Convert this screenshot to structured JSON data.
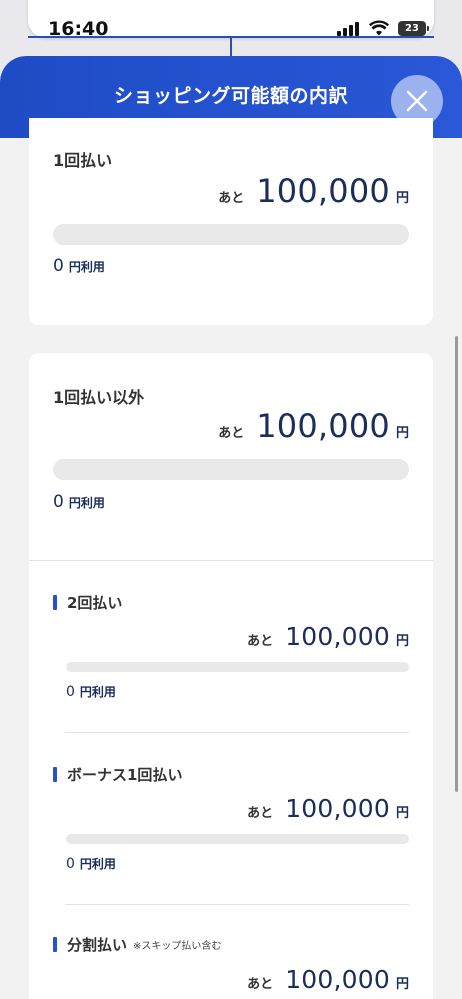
{
  "status_bar": {
    "time": "16:40",
    "battery": "23"
  },
  "sheet": {
    "title": "ショッピング可能額の内訳"
  },
  "lump_sum": {
    "label": "1回払い",
    "remaining_prefix": "あと",
    "remaining_amount": "100,000",
    "currency": "円",
    "used_amount": "0",
    "used_suffix": "円利用",
    "usage_fraction": 0
  },
  "other_than_lump_sum": {
    "label": "1回払い以外",
    "remaining_prefix": "あと",
    "remaining_amount": "100,000",
    "currency": "円",
    "used_amount": "0",
    "used_suffix": "円利用",
    "usage_fraction": 0,
    "breakdown": [
      {
        "label": "2回払い",
        "note": "",
        "remaining_prefix": "あと",
        "remaining_amount": "100,000",
        "currency": "円",
        "used_amount": "0",
        "used_suffix": "円利用",
        "usage_fraction": 0
      },
      {
        "label": "ボーナス1回払い",
        "note": "",
        "remaining_prefix": "あと",
        "remaining_amount": "100,000",
        "currency": "円",
        "used_amount": "0",
        "used_suffix": "円利用",
        "usage_fraction": 0
      },
      {
        "label": "分割払い",
        "note": "※スキップ払い含む",
        "remaining_prefix": "あと",
        "remaining_amount": "100,000",
        "currency": "円"
      }
    ]
  },
  "colors": {
    "accent": "#2553d0",
    "amount_text": "#1b2d5b",
    "track": "#e9e9e9"
  }
}
